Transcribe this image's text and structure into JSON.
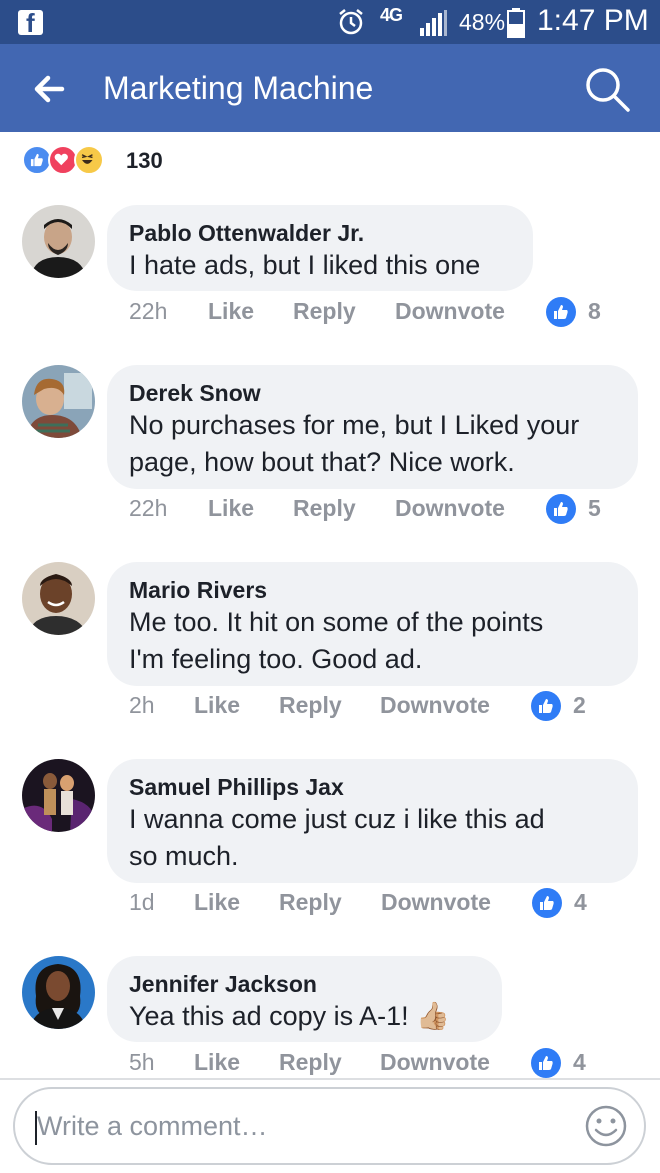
{
  "status_bar": {
    "network": "4G",
    "battery": "48%",
    "time": "1:47 PM",
    "fb_letter": "f"
  },
  "header": {
    "title": "Marketing Machine",
    "back_icon": "arrow-left-icon",
    "search_icon": "search-icon",
    "color": "#4267b2"
  },
  "reactions": {
    "types": [
      "like",
      "love",
      "haha"
    ],
    "count": "130"
  },
  "comments": [
    {
      "author": "Pablo Ottenwalder Jr.",
      "lines": [
        "I hate ads, but I liked this one"
      ],
      "time": "22h",
      "likes": "8"
    },
    {
      "author": "Derek Snow",
      "lines": [
        "No purchases for me, but I Liked your",
        "page, how bout that? Nice work."
      ],
      "time": "22h",
      "likes": "5"
    },
    {
      "author": "Mario Rivers",
      "lines": [
        "Me too. It hit on some of the points",
        "I'm feeling too. Good ad."
      ],
      "time": "2h",
      "likes": "2"
    },
    {
      "author": "Samuel Phillips Jax",
      "lines": [
        "I wanna come just cuz i like this ad",
        "so much."
      ],
      "time": "1d",
      "likes": "4"
    },
    {
      "author": "Jennifer Jackson",
      "lines": [
        "Yea this ad copy is A-1! 👍🏼"
      ],
      "time": "5h",
      "likes": "4"
    }
  ],
  "actions": {
    "like": "Like",
    "reply": "Reply",
    "downvote": "Downvote"
  },
  "composer": {
    "placeholder": "Write a comment…",
    "emoji_icon": "smiley-icon"
  }
}
